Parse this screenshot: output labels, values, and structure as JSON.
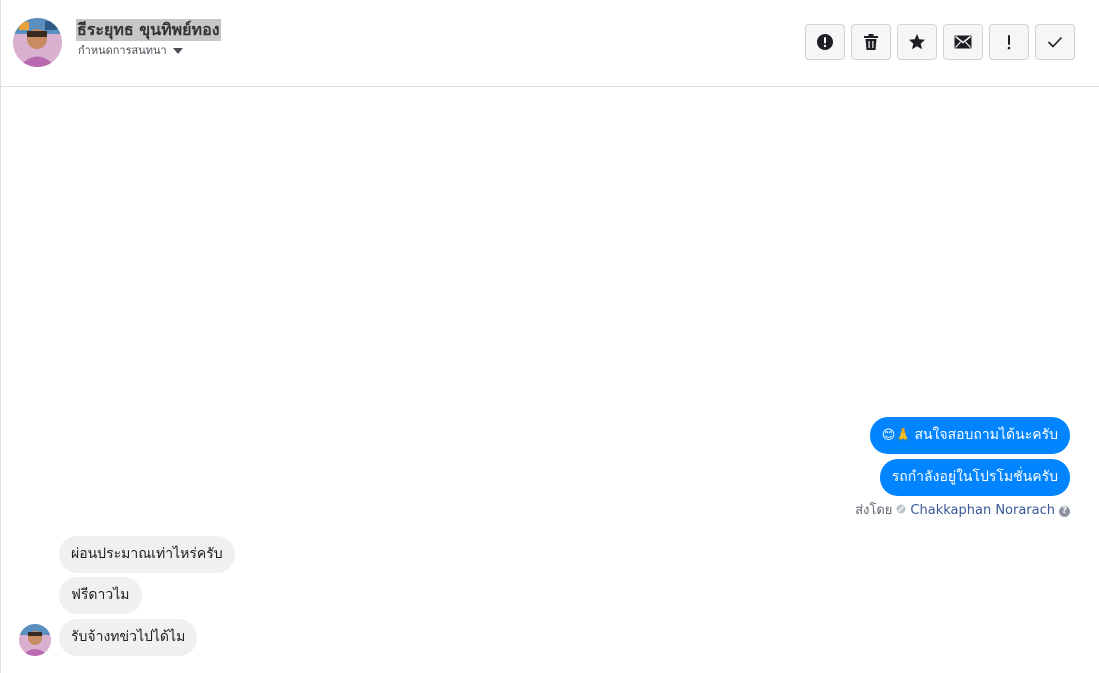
{
  "header": {
    "contact_name": "ธีระยุทธ ขุนทิพย์ทอง",
    "subtitle": "กำหนดการสนทนา",
    "toolbar": [
      {
        "name": "report-icon"
      },
      {
        "name": "trash-icon"
      },
      {
        "name": "star-icon"
      },
      {
        "name": "mail-icon"
      },
      {
        "name": "exclamation-icon"
      },
      {
        "name": "checkmark-icon"
      }
    ]
  },
  "conversation": {
    "outgoing": [
      {
        "emoji": "😊🙏",
        "text": "สนใจสอบถามได้นะครับ"
      },
      {
        "text": "รถกำลังอยู่ในโปรโมชั่นครับ"
      }
    ],
    "sent_by_label": "ส่งโดย",
    "sent_by_name": "Chakkaphan Norarach",
    "incoming": [
      {
        "text": "ผ่อนประมาณเท่าไหร่ครับ"
      },
      {
        "text": "ฟรีดาวไม"
      },
      {
        "text": "รับจ้างทข่วไปได้ไม"
      }
    ]
  },
  "photos": [
    "truck-front-left",
    "truck-rear-left",
    "truck-front",
    "truck-rear",
    "truck-side",
    "truck-wheel",
    "interior-dashboard",
    "engine-bay",
    "interior-wheel",
    "interior-seats",
    "interior-gearshift",
    "interior-rear-seats"
  ],
  "colors": {
    "accent": "#0084ff",
    "incoming_bubble": "#f1f0f0",
    "link": "#385898"
  }
}
